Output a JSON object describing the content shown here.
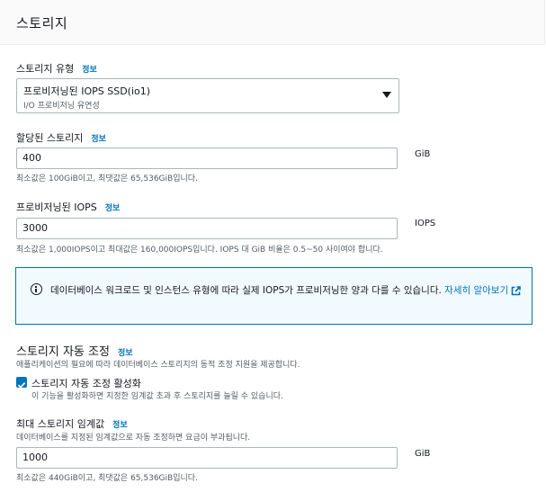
{
  "header": {
    "title": "스토리지"
  },
  "storage_type": {
    "label": "스토리지 유형",
    "info": "정보",
    "selected_value": "프로비저닝된 IOPS SSD(io1)",
    "selected_description": "I/O 프로비저닝 유연성"
  },
  "allocated_storage": {
    "label": "할당된 스토리지",
    "info": "정보",
    "value": "400",
    "unit": "GiB",
    "hint": "최소값은 100GiB이고, 최댓값은 65,536GiB입니다."
  },
  "provisioned_iops": {
    "label": "프로비저닝된 IOPS",
    "info": "정보",
    "value": "3000",
    "unit": "IOPS",
    "hint": "최소값은 1,000IOPS이고 최대값은 160,000IOPS입니다. IOPS 대 GiB 비율은 0.5~50 사이여야 합니다."
  },
  "alert": {
    "text": "데이터베이스 워크로드 및 인스턴스 유형에 따라 실제 IOPS가 프로비저닝한 양과 다를 수 있습니다. ",
    "link": "자세히 알아보기"
  },
  "autoscaling": {
    "title": "스토리지 자동 조정",
    "info": "정보",
    "description": "애플리케이션의 필요에 따라 데이터베이스 스토리지의 동적 조정 지원을 제공합니다.",
    "checkbox_label": "스토리지 자동 조정 활성화",
    "checkbox_checked": true,
    "checkbox_description": "이 기능을 활성화하면 지정한 임계값 초과 후 스토리지를 늘릴 수 있습니다."
  },
  "max_threshold": {
    "label": "최대 스토리지 임계값",
    "info": "정보",
    "description": "데이터베이스를 지정된 임계값으로 자동 조정하면 요금이 부과됩니다.",
    "value": "1000",
    "unit": "GiB",
    "hint": "최소값은 440GiB이고, 최댓값은 65,536GiB입니다."
  },
  "colors": {
    "link": "#0073bb",
    "alert_bg": "#f1faff",
    "border": "#aab7b8",
    "secondary_text": "#545b64"
  },
  "icons": [
    "info-circle-icon",
    "external-link-icon",
    "dropdown-caret-icon",
    "checkmark-icon"
  ]
}
